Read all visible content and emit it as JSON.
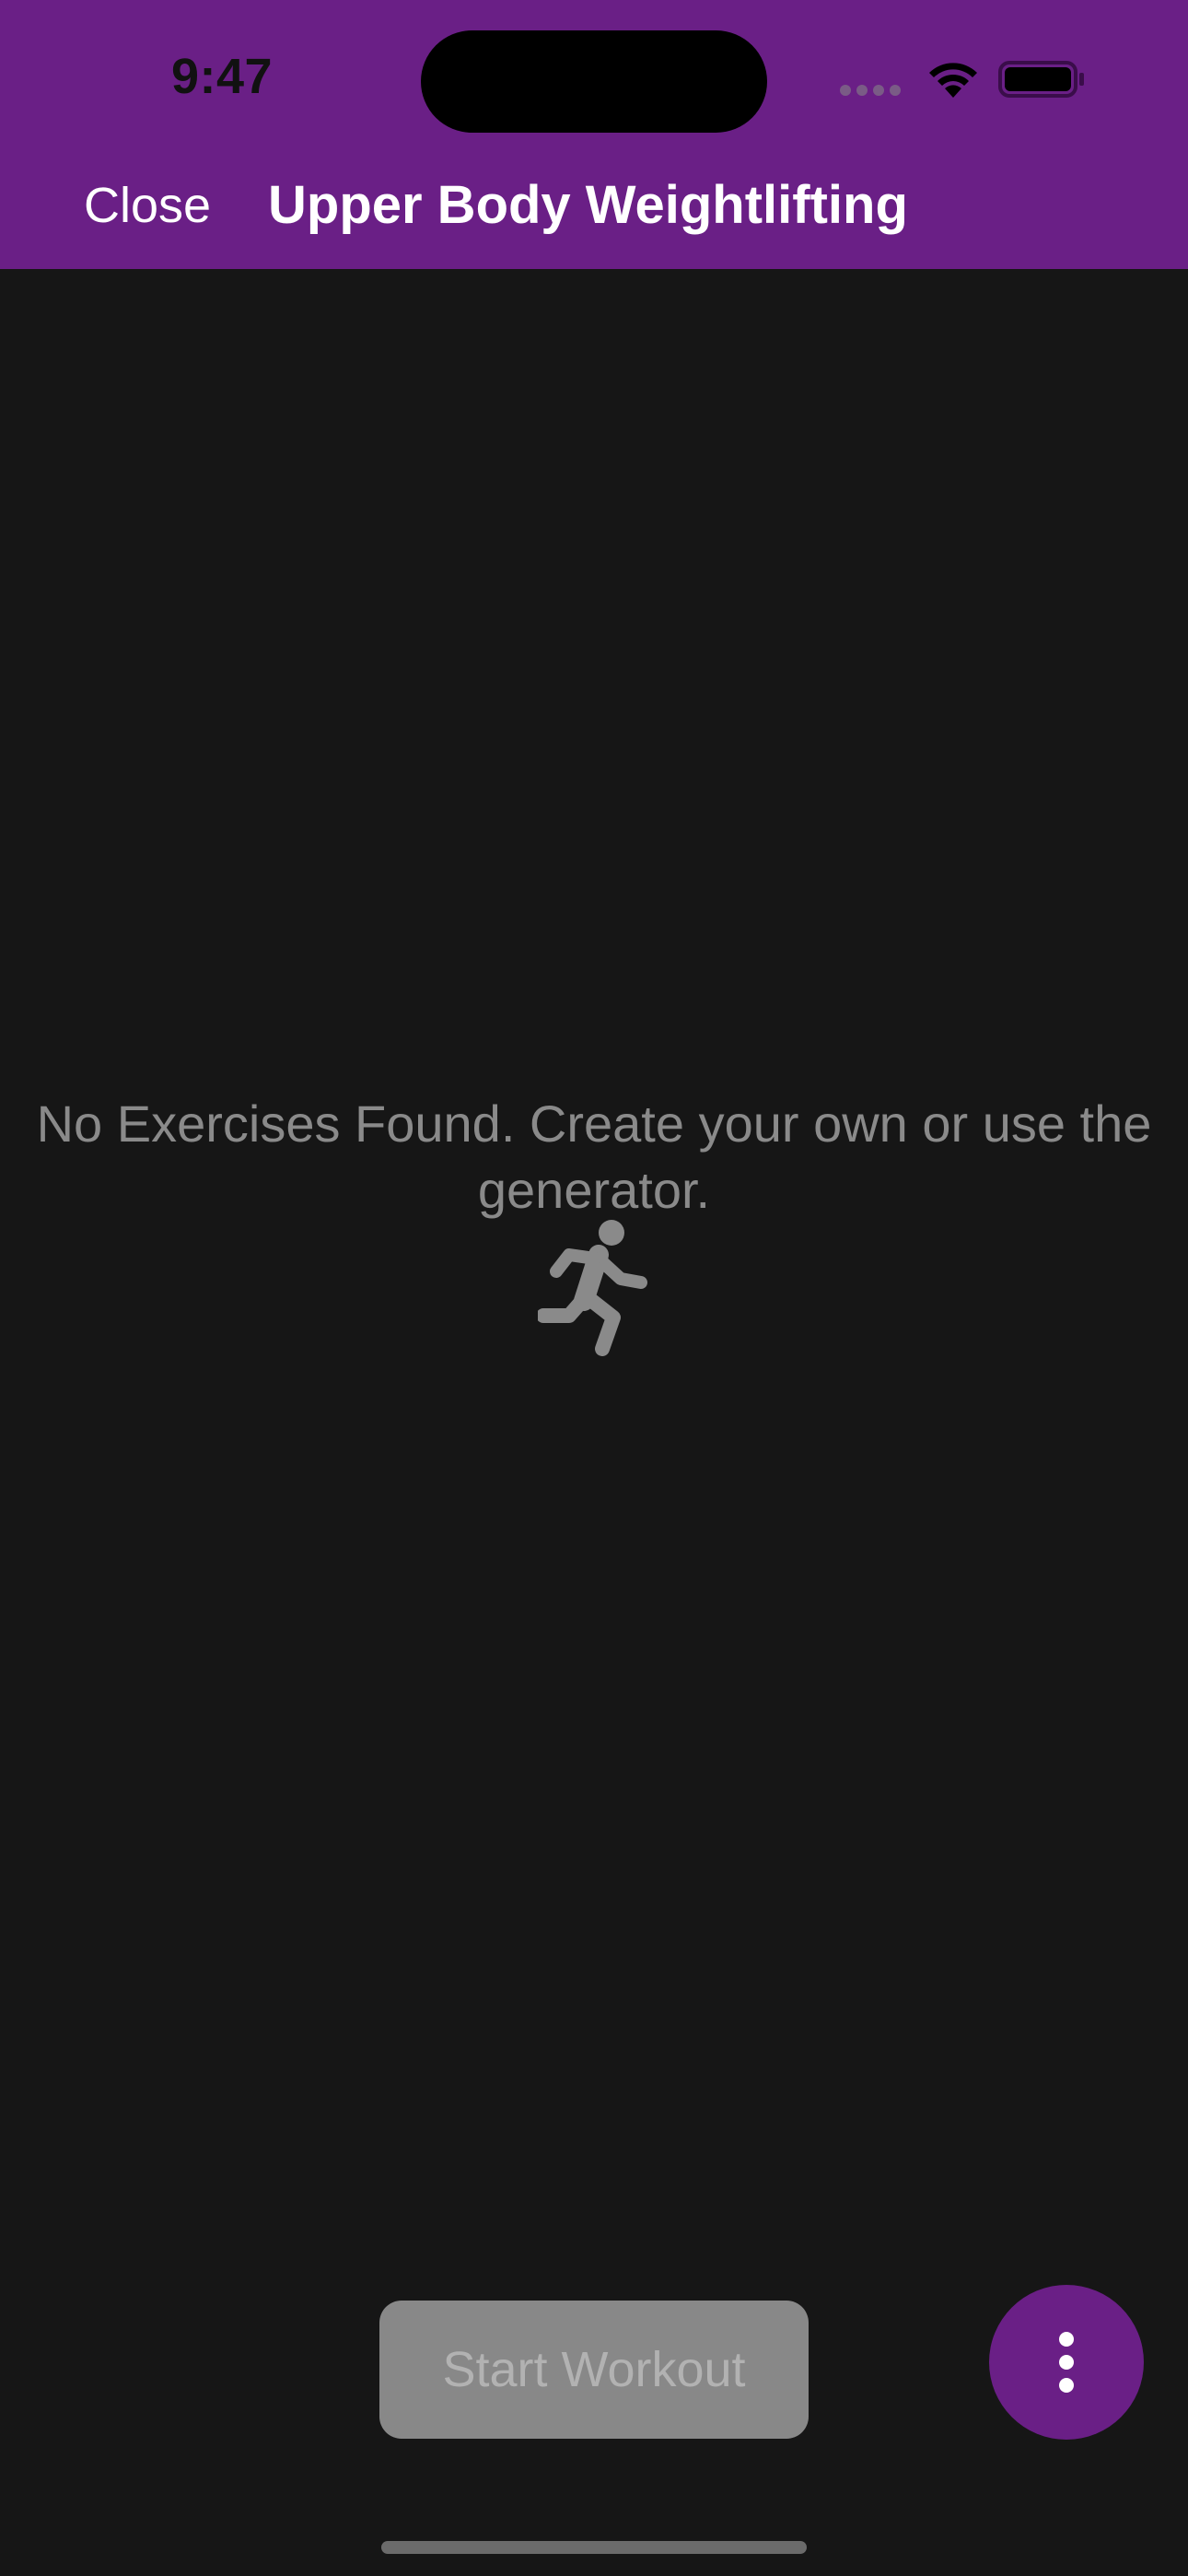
{
  "status_bar": {
    "time": "9:47"
  },
  "nav": {
    "close_label": "Close",
    "title": "Upper Body Weightlifting"
  },
  "empty_state": {
    "message": "No Exercises Found. Create your own or use the generator.",
    "icon": "running-figure-icon"
  },
  "actions": {
    "start_workout_label": "Start Workout",
    "more_icon": "vertical-ellipsis-icon"
  },
  "colors": {
    "accent": "#6a1f86",
    "background": "#161616",
    "muted_text": "#8a8a8a",
    "disabled_button": "#888888"
  }
}
